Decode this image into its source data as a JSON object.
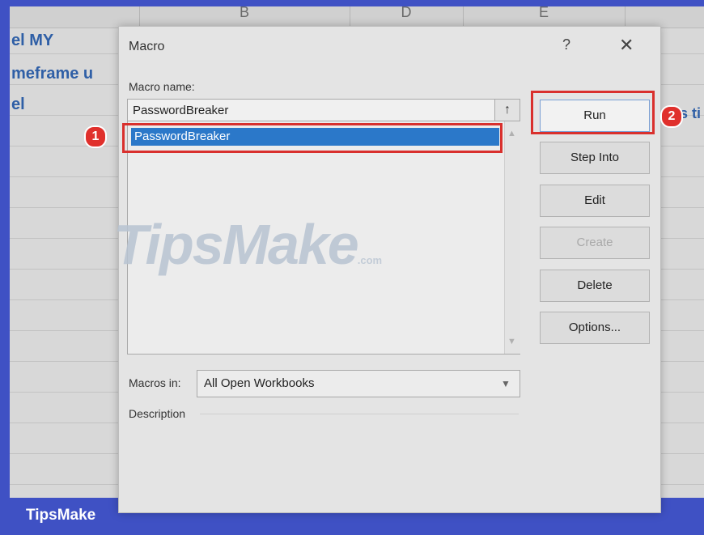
{
  "sheet": {
    "column_headers": [
      "B",
      "D",
      "E"
    ],
    "cells": [
      "el MY",
      "meframe u",
      "el",
      "s ti"
    ]
  },
  "dialog": {
    "title": "Macro",
    "help_label": "?",
    "close_label": "✕",
    "macro_name_label": "Macro name:",
    "macro_name_value": "PasswordBreaker",
    "upload_icon": "↑",
    "list_items": [
      "PasswordBreaker"
    ],
    "buttons": {
      "run": "Run",
      "step_into": "Step Into",
      "edit": "Edit",
      "create": "Create",
      "delete": "Delete",
      "options": "Options..."
    },
    "macros_in_label": "Macros in:",
    "macros_in_value": "All Open Workbooks",
    "description_label": "Description"
  },
  "annotations": {
    "step1": "1",
    "step2": "2",
    "callout_color": "#d9302d"
  },
  "watermark": {
    "text": "TipsMake",
    "suffix": ".com"
  },
  "footer": {
    "brand": "TipsMake",
    "background": "#3f51c4"
  }
}
